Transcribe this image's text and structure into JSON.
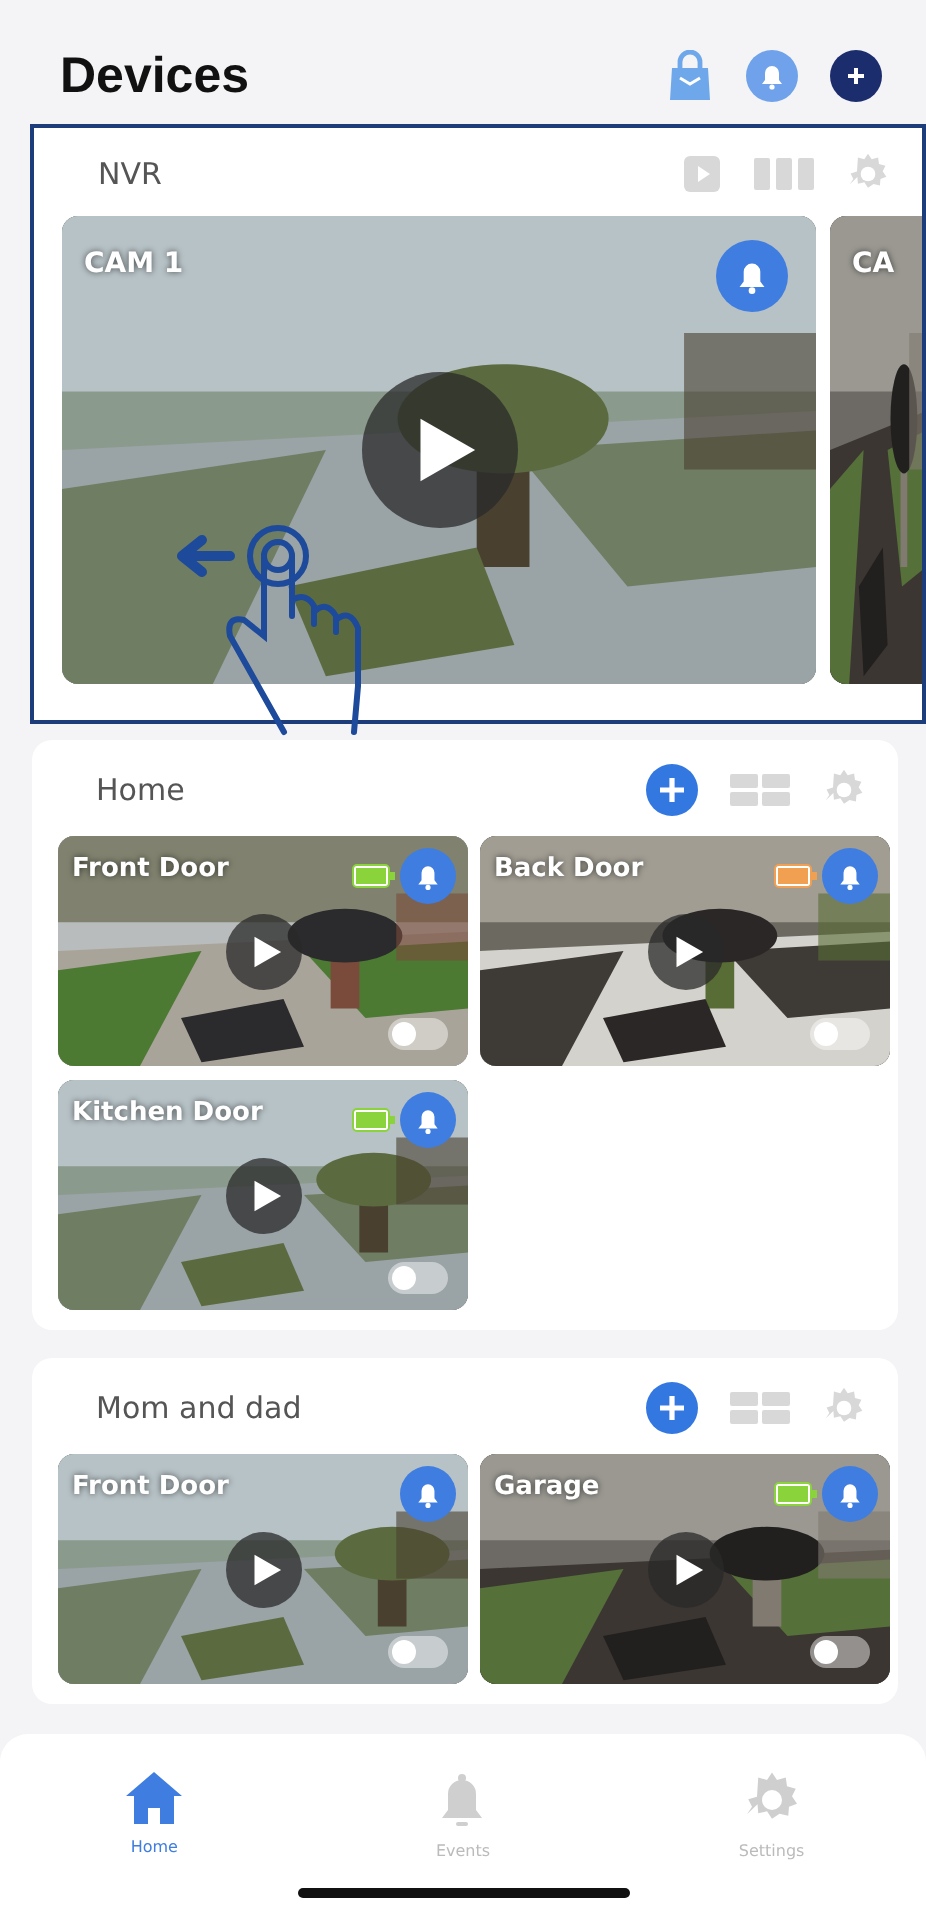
{
  "header": {
    "title": "Devices"
  },
  "groups": [
    {
      "name": "NVR",
      "kind": "nvr",
      "highlighted": true,
      "swipe_hint": true,
      "cameras": [
        {
          "name": "CAM 1",
          "partial": false
        },
        {
          "name": "CA",
          "partial": true
        }
      ]
    },
    {
      "name": "Home",
      "kind": "group",
      "highlighted": false,
      "cameras": [
        {
          "name": "Front Door",
          "color": "#8bd33a",
          "toggle": false,
          "partial": false
        },
        {
          "name": "Back Door",
          "color": "#f0a050",
          "toggle": false,
          "partial": false
        },
        {
          "name": "Kitchen Door",
          "color": "#8bd33a",
          "toggle": false,
          "partial": false
        }
      ]
    },
    {
      "name": "Mom and dad",
      "kind": "group",
      "highlighted": false,
      "cameras": [
        {
          "name": "Front Door",
          "toggle": false,
          "partial": false
        },
        {
          "name": "Garage",
          "color": "#8bd33a",
          "toggle": false,
          "partial": false
        }
      ]
    }
  ],
  "tabs": [
    {
      "label": "Home",
      "kind": "home",
      "selected": true
    },
    {
      "label": "Events",
      "kind": "bell",
      "selected": false
    },
    {
      "label": "Settings",
      "kind": "gear",
      "selected": false
    }
  ]
}
